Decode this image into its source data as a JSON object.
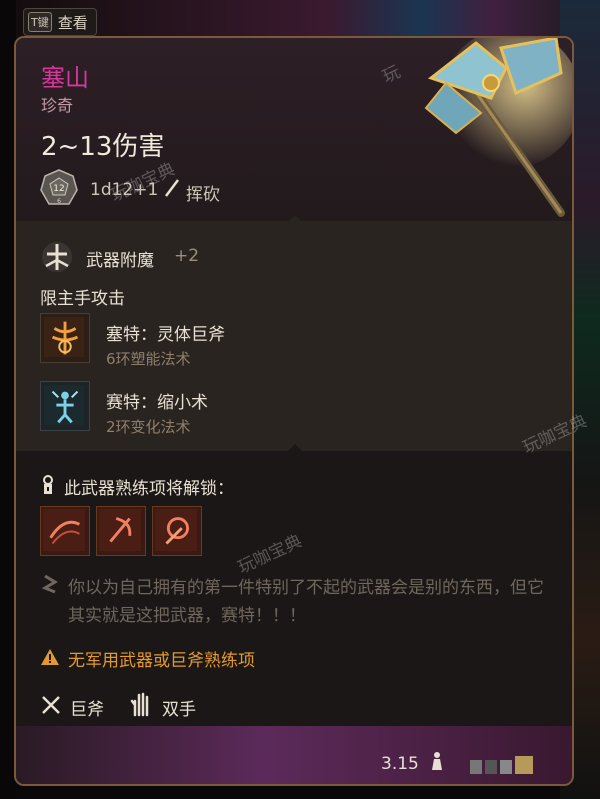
{
  "hotkey": {
    "key": "T键",
    "label": "查看"
  },
  "item": {
    "name": "塞山",
    "rarity": "珍奇",
    "damage": "2~13伤害",
    "die_value": "12",
    "die_sub": "6",
    "dice": "1d12+1",
    "damage_type": "挥砍"
  },
  "enchant": {
    "label": "武器附魔",
    "bonus": "+2",
    "restriction": "限主手攻击"
  },
  "spells": [
    {
      "name": "塞特：灵体巨斧",
      "school": "6环塑能法术",
      "icon": "spectral-axe-icon"
    },
    {
      "name": "赛特：缩小术",
      "school": "2环变化法术",
      "icon": "reduce-icon"
    }
  ],
  "proficiency": {
    "label": "此武器熟练项将解锁：",
    "actions": [
      {
        "icon": "cleave-action-icon"
      },
      {
        "icon": "lacerate-action-icon"
      },
      {
        "icon": "topple-action-icon"
      }
    ]
  },
  "flavor": "你以为自己拥有的第一件特别了不起的武器会是别的东西，但它其实就是这把武器，赛特！！！",
  "warning": "无军用武器或巨斧熟练项",
  "properties": {
    "weapon_type": "巨斧",
    "handedness": "双手"
  },
  "footer": {
    "weight": "3.15"
  },
  "watermark": {
    "text": "玩咖宝典",
    "text_short": "玩"
  },
  "colors": {
    "legendary_name": "#d6379a",
    "warning": "#e29a30",
    "border": "#7a5a3a"
  }
}
